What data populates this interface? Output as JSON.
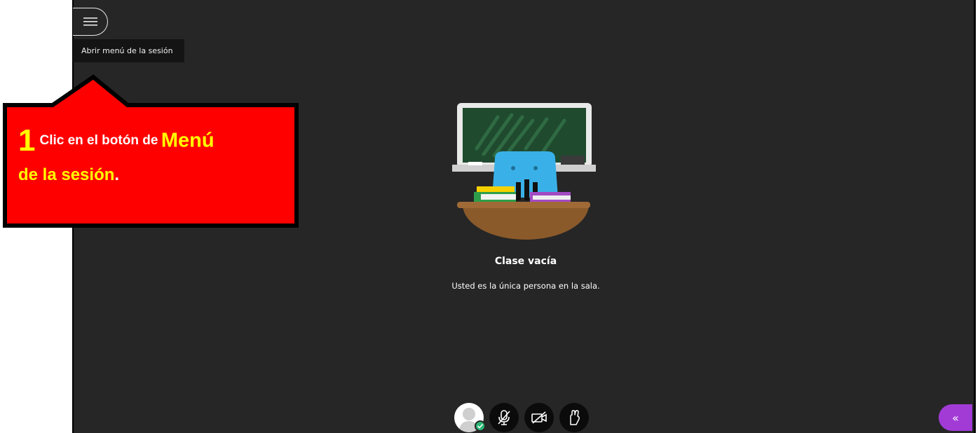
{
  "menu": {
    "icon": "hamburger-icon",
    "tooltip": "Abrir menú de la sesión"
  },
  "callout": {
    "number": "1",
    "text_a": "Clic en el botón de",
    "text_b": "Menú",
    "text_c": "de la sesión",
    "text_d": ".",
    "fill": "#ff0000",
    "accent": "#ffff00"
  },
  "room": {
    "title": "Clase vacía",
    "subtitle": "Usted es la única persona en la sala.",
    "illustration": "classroom-illustration"
  },
  "controls": {
    "avatar": "user-avatar",
    "status": "check-icon",
    "mic": "microphone-muted-icon",
    "camera": "camera-off-icon",
    "hand": "raise-hand-icon"
  },
  "panel": {
    "collapse_glyph": "«",
    "color": "#a23bd6"
  },
  "colors": {
    "stage": "#262626",
    "status_green": "#2bb673"
  }
}
